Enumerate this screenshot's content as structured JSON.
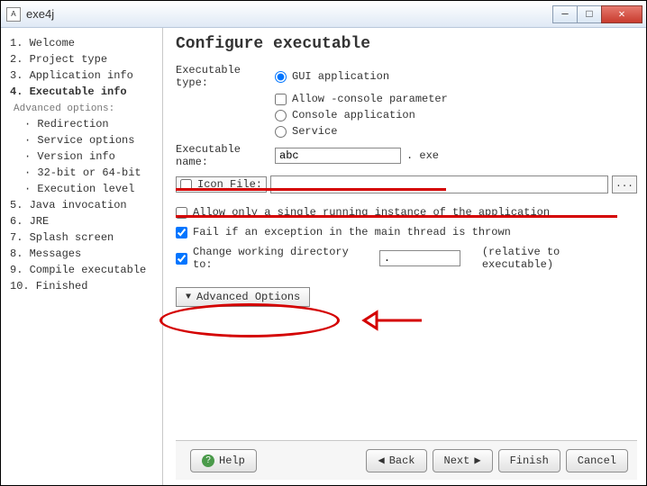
{
  "window": {
    "title": "exe4j"
  },
  "sidebar": {
    "items": [
      "1. Welcome",
      "2. Project type",
      "3. Application info",
      "4. Executable info",
      "5. Java invocation",
      "6. JRE",
      "7. Splash screen",
      "8. Messages",
      "9. Compile executable",
      "10. Finished"
    ],
    "active_index": 3,
    "advanced_label": "Advanced options:",
    "advanced": [
      "Redirection",
      "Service options",
      "Version info",
      "32-bit or 64-bit",
      "Execution level"
    ],
    "logo": "exe4j"
  },
  "content": {
    "heading": "Configure executable",
    "exec_type_label": "Executable type:",
    "radio_gui": "GUI application",
    "allow_console_cb": "Allow -console parameter",
    "radio_console": "Console application",
    "radio_service": "Service",
    "exec_name_label": "Executable name:",
    "exec_name_value": "abc",
    "exec_ext": ". exe",
    "icon_file_label": "Icon File:",
    "icon_file_value": "",
    "browse_label": "...",
    "single_instance": "Allow only a single running instance of the application",
    "fail_exception": "Fail if an exception in the main thread is thrown",
    "change_wd": "Change working directory to:",
    "wd_value": ".",
    "rel_note": "(relative to executable)",
    "advanced_btn": "Advanced Options"
  },
  "footer": {
    "help": "Help",
    "back": "Back",
    "next": "Next",
    "finish": "Finish",
    "cancel": "Cancel"
  }
}
